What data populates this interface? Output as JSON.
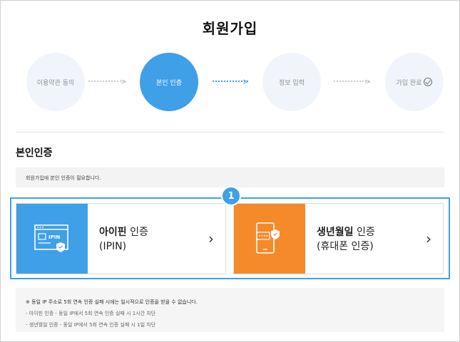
{
  "page_title": "회원가입",
  "steps": [
    {
      "label": "이용약관 동의",
      "active": false
    },
    {
      "label": "본인 인증",
      "active": true
    },
    {
      "label": "정보 입력",
      "active": false
    },
    {
      "label": "가입 완료",
      "active": false
    }
  ],
  "section_title": "본인인증",
  "notice": "회원가입에 본인 인증이 필요합니다.",
  "callout_number": "1",
  "cards": {
    "ipin": {
      "title_bold": "아이핀",
      "title_rest": " 인증",
      "subtitle": "(IPIN)",
      "icon_text": "IPIN",
      "color": "#3fa0e8",
      "arrow": "›"
    },
    "birth": {
      "title_bold": "생년월일",
      "title_rest": " 인증",
      "subtitle": "(휴대폰 인증)",
      "color": "#f58a2a",
      "arrow": "›"
    }
  },
  "info": {
    "lead": "※ 동일 IP 주소로 5회 연속 인증 실패 시에는 일시적으로 인증을 받을 수 없습니다.",
    "line1": "- 아이핀 인증 - 동일 IP에서 5회 연속 인증 실패 시 1시간 차단",
    "line2": "- 생년월일 인증 - 동일 IP에서 5회 연속 인증 실패 시 1일 차단"
  },
  "colors": {
    "accent": "#3fa0e8",
    "orange": "#f58a2a"
  }
}
